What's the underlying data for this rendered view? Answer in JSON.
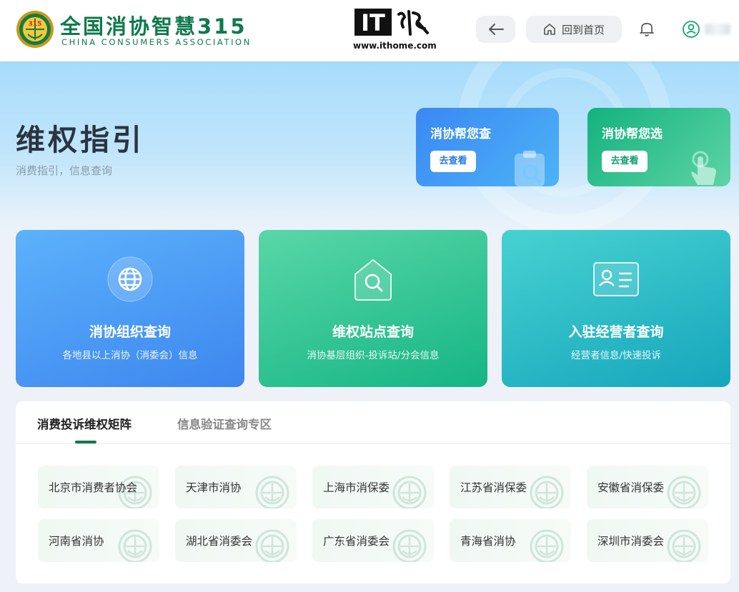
{
  "header": {
    "logo_cn": "全国消协智慧315",
    "logo_en": "CHINA CONSUMERS ASSOCIATION",
    "logo_seal_text": "315",
    "watermark_brand": "IT之家",
    "watermark_url": "www.ithome.com",
    "back_icon": "arrow-left-icon",
    "home_label": "回到首页",
    "home_icon": "home-icon",
    "bell_icon": "bell-icon",
    "user_icon": "user-icon"
  },
  "hero": {
    "title": "维权指引",
    "subtitle": "消费指引，信息查询",
    "cards": [
      {
        "title": "消协帮您查",
        "button": "去查看",
        "icon": "clipboard-search-icon"
      },
      {
        "title": "消协帮您选",
        "button": "去查看",
        "icon": "tap-hand-icon"
      }
    ]
  },
  "services": [
    {
      "title": "消协组织查询",
      "subtitle": "各地县以上消协（消委会）信息",
      "icon": "globe-icon"
    },
    {
      "title": "维权站点查询",
      "subtitle": "消协基层组织-投诉站/分会信息",
      "icon": "house-search-icon"
    },
    {
      "title": "入驻经营者查询",
      "subtitle": "经营者信息/快速投诉",
      "icon": "id-card-icon"
    }
  ],
  "tabs": [
    {
      "label": "消费投诉维权矩阵",
      "active": true
    },
    {
      "label": "信息验证查询专区",
      "active": false
    }
  ],
  "organizations": [
    "北京市消费者协会",
    "天津市消协",
    "上海市消保委",
    "江苏省消保委",
    "安徽省消保委",
    "河南省消协",
    "湖北省消委会",
    "广东省消委会",
    "青海省消协",
    "深圳市消委会"
  ],
  "colors": {
    "brand_green": "#0f7a4c",
    "card_blue": "#3d86ef",
    "card_green": "#16b584",
    "card_teal": "#16a6bd"
  }
}
